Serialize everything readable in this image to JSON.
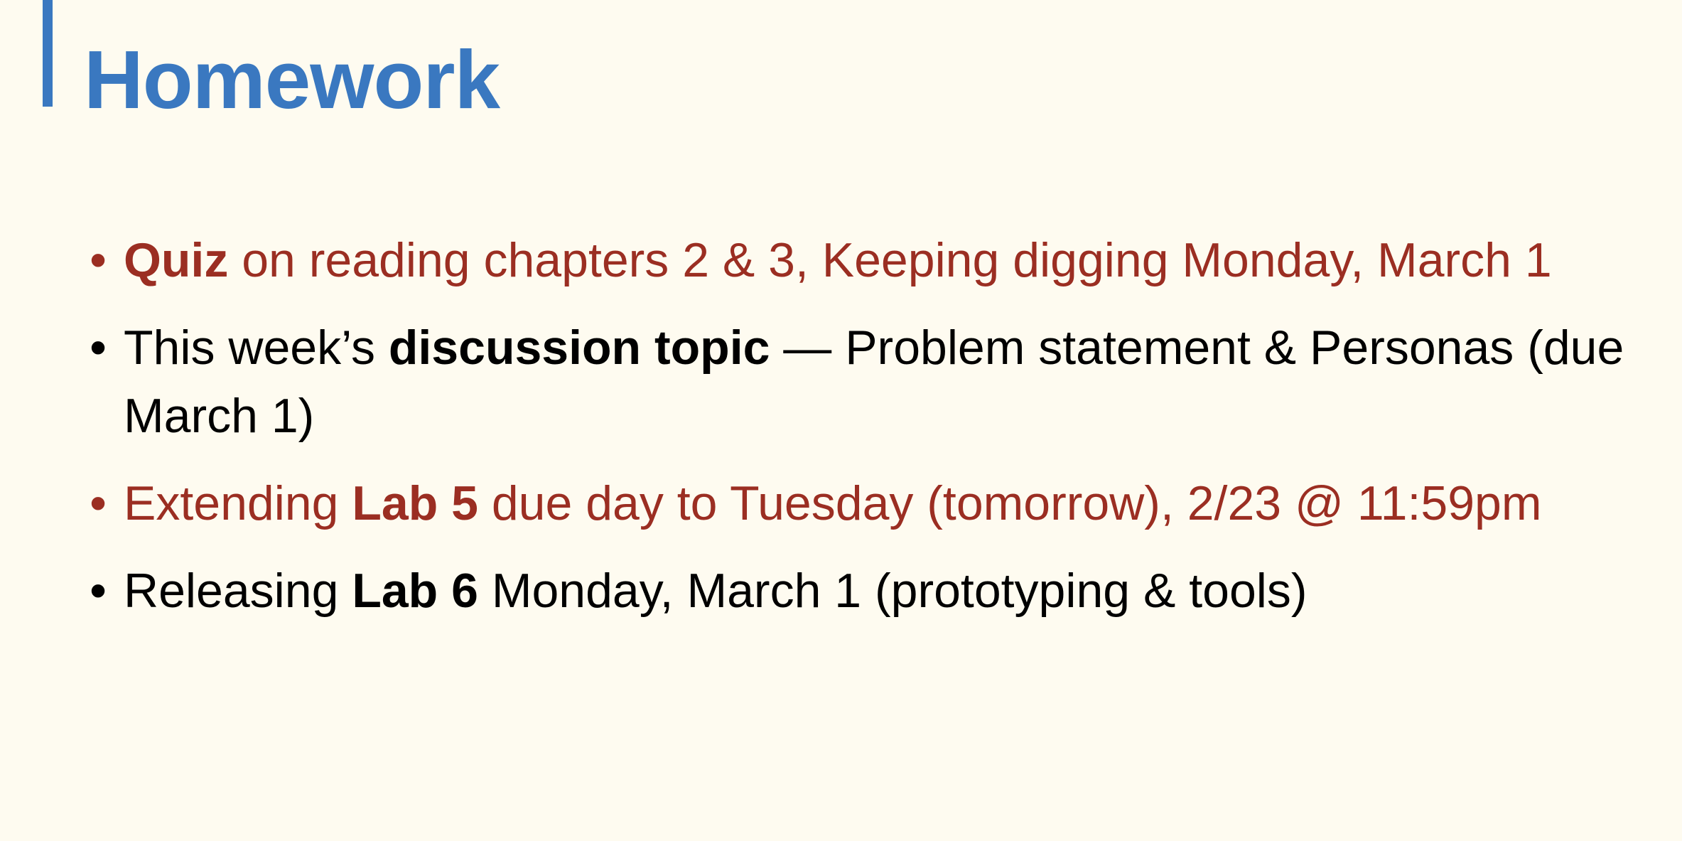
{
  "slide": {
    "title": "Homework",
    "colors": {
      "background": "#fefbf0",
      "title": "#3a78c0",
      "accent_bar": "#3a78c0",
      "highlight_text": "#9b2e22",
      "body_text": "#000000"
    },
    "bullet_symbol": "•",
    "bullets": [
      {
        "color": "red",
        "parts": [
          {
            "text": "Quiz",
            "bold": true
          },
          {
            "text": " on reading chapters 2 & 3, Keeping digging Monday, March 1",
            "bold": false
          }
        ]
      },
      {
        "color": "black",
        "parts": [
          {
            "text": "This week’s ",
            "bold": false
          },
          {
            "text": "discussion topic",
            "bold": true
          },
          {
            "text": " — Problem statement & Personas (due March 1)",
            "bold": false
          }
        ]
      },
      {
        "color": "red",
        "parts": [
          {
            "text": "Extending ",
            "bold": false
          },
          {
            "text": "Lab 5",
            "bold": true
          },
          {
            "text": " due day to Tuesday (tomorrow), 2/23 @ 11:59pm",
            "bold": false
          }
        ]
      },
      {
        "color": "black",
        "parts": [
          {
            "text": "Releasing ",
            "bold": false
          },
          {
            "text": "Lab 6",
            "bold": true
          },
          {
            "text": " Monday, March 1 (prototyping & tools)",
            "bold": false
          }
        ]
      }
    ]
  }
}
